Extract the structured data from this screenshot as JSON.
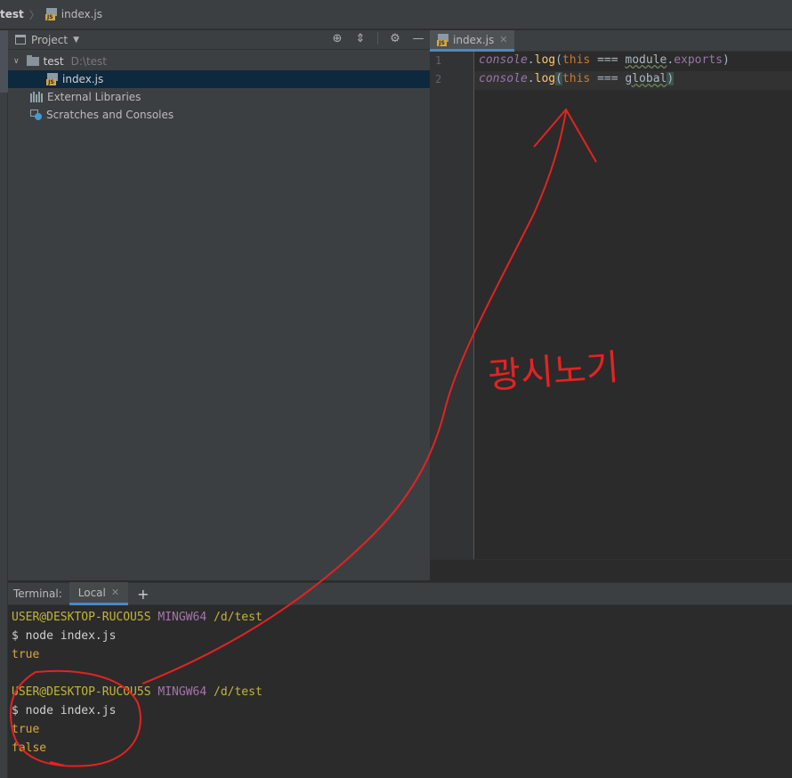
{
  "breadcrumb": {
    "root": "test",
    "file": "index.js"
  },
  "project_panel": {
    "title": "Project",
    "tree": [
      {
        "label": "test",
        "path": "D:\\test"
      },
      {
        "label": "index.js"
      },
      {
        "label": "External Libraries"
      },
      {
        "label": "Scratches and Consoles"
      }
    ]
  },
  "editor": {
    "tab_label": "index.js",
    "line_numbers": [
      "1",
      "2"
    ],
    "lines": [
      [
        "console",
        ".",
        "log",
        "(",
        "this",
        " === ",
        "module",
        ".",
        "exports",
        ")"
      ],
      [
        "console",
        ".",
        "log",
        "(",
        "this",
        " === ",
        "global",
        ")"
      ]
    ]
  },
  "terminal": {
    "label": "Terminal:",
    "tab_label": "Local",
    "blocks": [
      {
        "user": "USER@DESKTOP-RUCOU5S",
        "host": "MINGW64",
        "path": "/d/test",
        "cmd": "$ node index.js",
        "output": [
          "true"
        ]
      },
      {
        "user": "USER@DESKTOP-RUCOU5S",
        "host": "MINGW64",
        "path": "/d/test",
        "cmd": "$ node index.js",
        "output": [
          "true",
          "false"
        ]
      }
    ]
  },
  "annotation": {
    "text": "광시노기",
    "color": "#e52222"
  },
  "colors": {
    "accent": "#4a88c7",
    "selection": "#0d293e",
    "annotation": "#e52222"
  },
  "icons": [
    "project-icon",
    "locate-icon",
    "collapse-icon",
    "gear-icon",
    "minimize-icon",
    "folder-icon",
    "js-file-icon",
    "library-icon",
    "scratches-icon",
    "close-icon",
    "add-icon"
  ]
}
